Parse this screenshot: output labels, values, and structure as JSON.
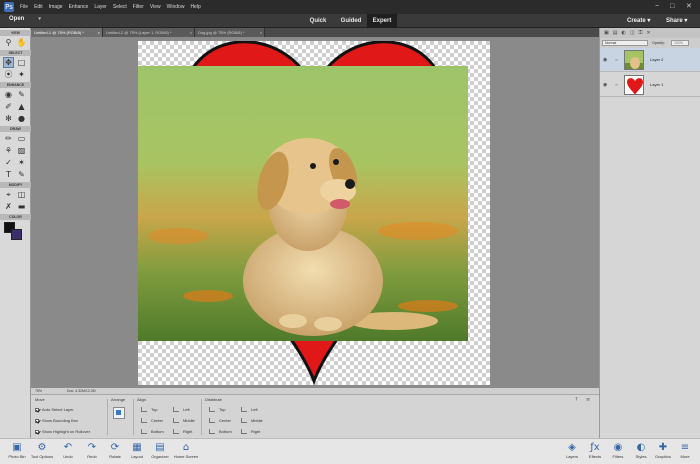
{
  "menu": {
    "logo": "Ps",
    "items": [
      "File",
      "Edit",
      "Image",
      "Enhance",
      "Layer",
      "Select",
      "Filter",
      "View",
      "Window",
      "Help"
    ],
    "win_minimize": "−",
    "win_maximize": "□",
    "win_close": "✕"
  },
  "modebar": {
    "open_label": "Open",
    "open_caret": "▾",
    "tabs": [
      "Quick",
      "Guided",
      "Expert"
    ],
    "active_tab": "Expert",
    "create_label": "Create ▾",
    "share_label": "Share ▾"
  },
  "doc_tabs": [
    {
      "label": "Untitled-1 @ 75% (RGB/8) *",
      "close": "×"
    },
    {
      "label": "Untitled-2 @ 75% (Layer 1, RGB/8) *",
      "close": "×"
    },
    {
      "label": "Dog.jpg @ 75% (RGB/8) *",
      "close": "×"
    }
  ],
  "toolbox": {
    "sections": [
      "VIEW",
      "SELECT",
      "ENHANCE",
      "DRAW",
      "MODIFY",
      "COLOR"
    ],
    "colors": {
      "foreground": "#111111",
      "background": "#3c2f68"
    }
  },
  "statusbar": {
    "zoom": "75%",
    "doc_info": "Doc: 4.32M/12.2M"
  },
  "tool_options": {
    "move_title": "Move",
    "auto_select": "Auto Select Layer",
    "show_bounding": "Show Bounding Box",
    "show_highlight": "Show Highlight on Rollover",
    "arrange_title": "Arrange",
    "align_title": "Align",
    "align_items": [
      "Top",
      "Center",
      "Bottom",
      "Left",
      "Middle",
      "Right"
    ],
    "distribute_title": "Distribute",
    "distribute_items": [
      "Top",
      "Center",
      "Bottom",
      "Left",
      "Middle",
      "Right"
    ]
  },
  "layers": {
    "blend_mode": "Normal",
    "opacity_label": "Opacity:",
    "opacity_value": "100%",
    "items": [
      {
        "name": "Layer 2"
      },
      {
        "name": "Layer 1"
      }
    ]
  },
  "bottombar": {
    "left": [
      {
        "label": "Photo Bin",
        "icon": "photo-bin-icon",
        "glyph": "▣"
      },
      {
        "label": "Tool Options",
        "icon": "tool-options-icon",
        "glyph": "⚙"
      },
      {
        "label": "Undo",
        "icon": "undo-icon",
        "glyph": "↶"
      },
      {
        "label": "Redo",
        "icon": "redo-icon",
        "glyph": "↷"
      },
      {
        "label": "Rotate",
        "icon": "rotate-icon",
        "glyph": "⟳"
      },
      {
        "label": "Layout",
        "icon": "layout-icon",
        "glyph": "▦"
      },
      {
        "label": "Organizer",
        "icon": "organizer-icon",
        "glyph": "▤"
      },
      {
        "label": "Home Screen",
        "icon": "home-icon",
        "glyph": "⌂"
      }
    ],
    "right": [
      {
        "label": "Layers",
        "icon": "layers-icon",
        "glyph": "◈"
      },
      {
        "label": "Effects",
        "icon": "effects-icon",
        "glyph": "ƒx"
      },
      {
        "label": "Filters",
        "icon": "filters-icon",
        "glyph": "◉"
      },
      {
        "label": "Styles",
        "icon": "styles-icon",
        "glyph": "◐"
      },
      {
        "label": "Graphics",
        "icon": "graphics-icon",
        "glyph": "✚"
      },
      {
        "label": "More",
        "icon": "more-icon",
        "glyph": "≡"
      }
    ]
  }
}
